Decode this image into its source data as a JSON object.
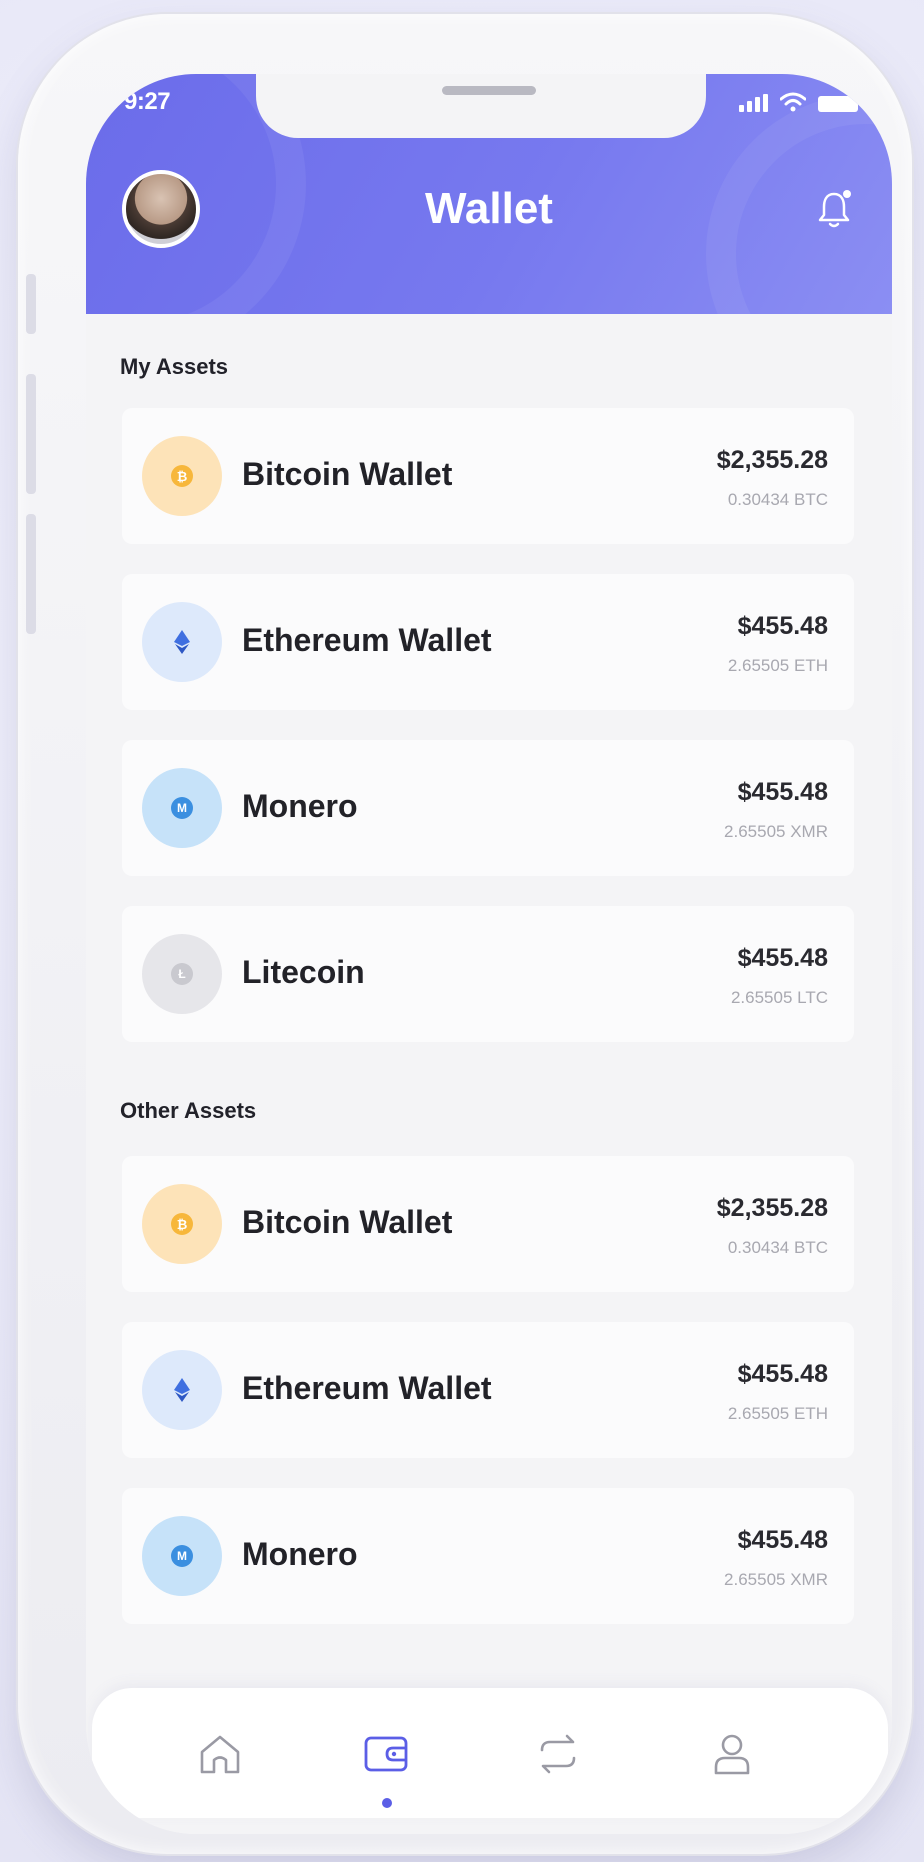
{
  "status_bar": {
    "time": "9:27"
  },
  "header": {
    "title": "Wallet"
  },
  "sections": [
    {
      "title": "My Assets"
    },
    {
      "title": "Other Assets"
    }
  ],
  "my_assets": [
    {
      "name": "Bitcoin Wallet",
      "usd": "$2,355.28",
      "amount": "0.30434 BTC",
      "icon": "bitcoin-icon",
      "color": "#f7b73b"
    },
    {
      "name": "Ethereum Wallet",
      "usd": "$455.48",
      "amount": "2.65505 ETH",
      "icon": "ethereum-icon",
      "color": "#3f6fe0"
    },
    {
      "name": "Monero",
      "usd": "$455.48",
      "amount": "2.65505 XMR",
      "icon": "monero-icon",
      "color": "#3b8fe0"
    },
    {
      "name": "Litecoin",
      "usd": "$455.48",
      "amount": "2.65505 LTC",
      "icon": "litecoin-icon",
      "color": "#a9a9b1"
    }
  ],
  "other_assets": [
    {
      "name": "Bitcoin Wallet",
      "usd": "$2,355.28",
      "amount": "0.30434 BTC",
      "icon": "bitcoin-icon",
      "color": "#f7b73b"
    },
    {
      "name": "Ethereum Wallet",
      "usd": "$455.48",
      "amount": "2.65505 ETH",
      "icon": "ethereum-icon",
      "color": "#3f6fe0"
    },
    {
      "name": "Monero",
      "usd": "$455.48",
      "amount": "2.65505 XMR",
      "icon": "monero-icon",
      "color": "#3b8fe0"
    }
  ],
  "nav": [
    {
      "icon": "home-icon",
      "active": false
    },
    {
      "icon": "wallet-icon",
      "active": true
    },
    {
      "icon": "swap-icon",
      "active": false
    },
    {
      "icon": "profile-icon",
      "active": false
    }
  ],
  "colors": {
    "accent": "#6b6cea",
    "background": "#f4f4f6"
  }
}
